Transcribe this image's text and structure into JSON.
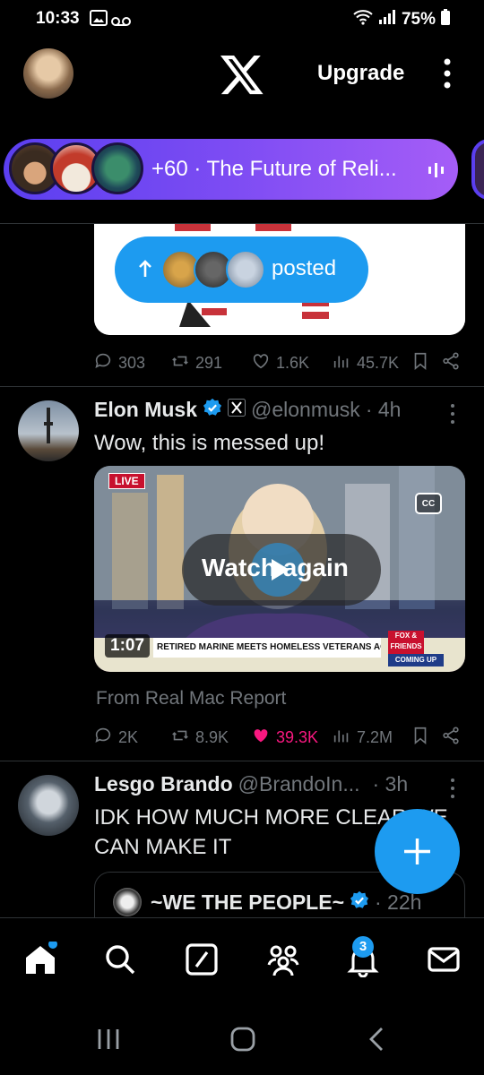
{
  "status_bar": {
    "time": "10:33",
    "battery": "75%"
  },
  "header": {
    "upgrade_label": "Upgrade"
  },
  "space": {
    "extra_count_title": "+60 · The Future of Reli..."
  },
  "top_tweet": {
    "posted_label": "posted",
    "replies": "303",
    "reposts": "291",
    "likes": "1.6K",
    "views": "45.7K"
  },
  "tweet": {
    "name": "Elon Musk",
    "handle": "@elonmusk",
    "time": "· 4h",
    "text": "Wow, this is messed up!",
    "video": {
      "live_badge": "LIVE",
      "cc_label": "CC",
      "overlay": "Watch again",
      "duration": "1:07",
      "chyron": "RETIRED MARINE MEETS HOMELESS VETERANS ACROSS U.S.",
      "network": "FOX & FRIENDS",
      "coming_up": "COMING UP"
    },
    "source": "From Real Mac Report",
    "replies": "2K",
    "reposts": "8.9K",
    "likes": "39.3K",
    "views": "7.2M"
  },
  "tweet2": {
    "name": "Lesgo Brando",
    "handle": "@BrandoIn...",
    "time": "· 3h",
    "text_line1": "IDK HOW MUCH MORE CLEAR WE",
    "text_line2": "CAN MAKE IT",
    "quote_name": "~WE THE PEOPLE~",
    "quote_time": "· 22h"
  },
  "nav": {
    "notifications_badge": "3"
  },
  "colors": {
    "accent": "#1d9bf0",
    "like": "#f91880",
    "space": "#7d4cf3"
  }
}
